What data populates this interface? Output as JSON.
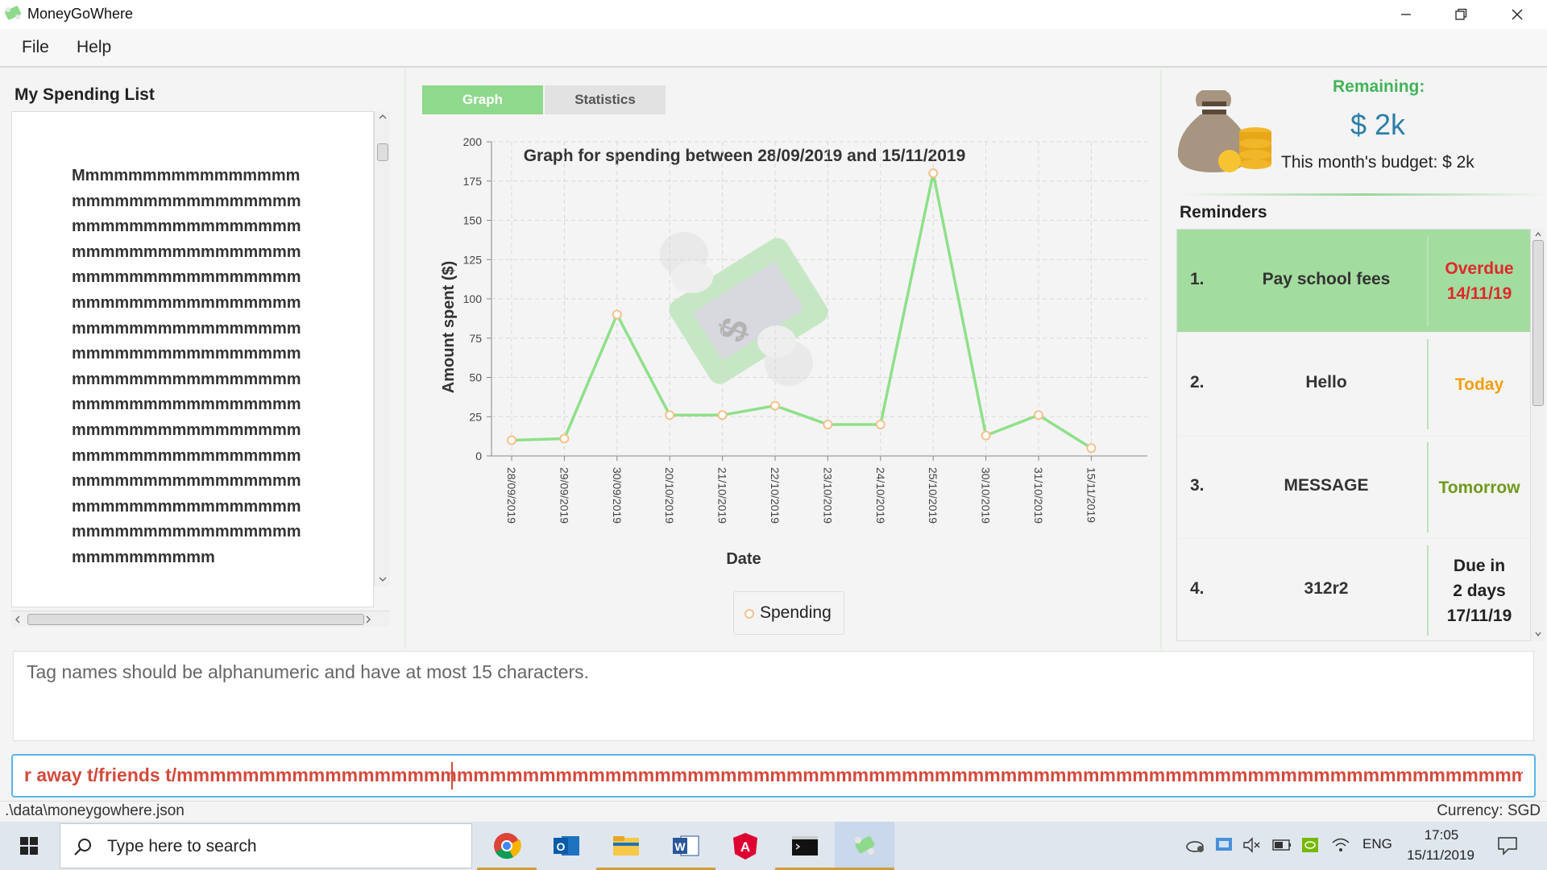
{
  "window": {
    "title": "MoneyGoWhere",
    "min_label": "—",
    "restore_label": "❐",
    "close_label": "✕"
  },
  "menu": {
    "file": "File",
    "help": "Help"
  },
  "spending_list": {
    "title": "My Spending List",
    "text": "Mmmmmmmmmmmmmmmmmmmmmmmmmmmmmmmmmmmmmmmmmmmmmmmmmmmmmmmmmmmmmmmmmmmmmmmmmmmmmmmmmmmmmmmmmmmmmmmmmmmmmmmmmmmmmmmmmmmmmmmmmmmmmmmmmmmmmmmmmmmmmmmmmmmmmmmmmmmmmmmmmmmmmmmmmmmmmmmmmmmmmmmmmmmmmmmmmmmmmmmmmmmmmmmmmmmmmmmmmmmmmmmmmmmmmmmmmmmmmmmmmmmmmmmmmm"
  },
  "tabs": {
    "graph": "Graph",
    "statistics": "Statistics"
  },
  "chart_data": {
    "type": "line",
    "title": "Graph for spending between 28/09/2019 and 15/11/2019",
    "xlabel": "Date",
    "ylabel": "Amount spent ($)",
    "ylim": [
      0,
      200
    ],
    "yticks": [
      0,
      25,
      50,
      75,
      100,
      125,
      150,
      175,
      200
    ],
    "grid": true,
    "legend_position": "bottom",
    "categories": [
      "28/09/2019",
      "29/09/2019",
      "30/09/2019",
      "20/10/2019",
      "21/10/2019",
      "22/10/2019",
      "23/10/2019",
      "24/10/2019",
      "25/10/2019",
      "30/10/2019",
      "31/10/2019",
      "15/11/2019"
    ],
    "series": [
      {
        "name": "Spending",
        "values": [
          10,
          11,
          90,
          26,
          26,
          32,
          20,
          20,
          180,
          13,
          26,
          5
        ]
      }
    ],
    "line_color": "#8fe08a",
    "marker_color": "#f7c08a"
  },
  "budget": {
    "remaining_label": "Remaining:",
    "remaining_value": "$ 2k",
    "month_budget": "This month's budget: $ 2k"
  },
  "reminders": {
    "title": "Reminders",
    "items": [
      {
        "num": "1.",
        "message": "Pay school fees",
        "due_lines": [
          "Overdue",
          "14/11/19"
        ],
        "due_color": "#e0282a",
        "highlight": true
      },
      {
        "num": "2.",
        "message": "Hello",
        "due_lines": [
          "Today"
        ],
        "due_color": "#f0a010",
        "highlight": false
      },
      {
        "num": "3.",
        "message": "MESSAGE",
        "due_lines": [
          "Tomorrow"
        ],
        "due_color": "#6f9a1e",
        "highlight": false
      },
      {
        "num": "4.",
        "message": "312r2",
        "due_lines": [
          "Due in",
          "2 days",
          "17/11/19"
        ],
        "due_color": "#222222",
        "highlight": false
      }
    ]
  },
  "result": {
    "text": "Tag names should be alphanumeric and have at most 15 characters."
  },
  "command": {
    "text": "r away t/friends t/mmmmmmmmmmmmmmmmmmmmmmmmmmmmmmmmmmmmmmmmmmmmmmmmmmmmmmmmmmmmmmmmmmmmmmmmmmmmmmmmmmmmmmmmmmmmmmmmmmmmmmmmmmmmmi"
  },
  "status": {
    "path": ".\\data\\moneygowhere.json",
    "currency": "Currency: SGD"
  },
  "taskbar": {
    "search_placeholder": "Type here to search",
    "language": "ENG",
    "time": "17:05",
    "date": "15/11/2019"
  }
}
